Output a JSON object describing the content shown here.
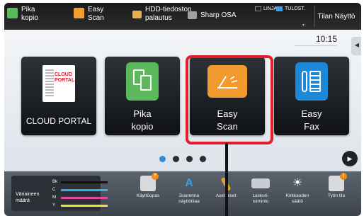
{
  "topbar": {
    "quick": [
      {
        "label": "Pika\nkopio",
        "icon": "copy-icon",
        "color": "#5cb85c"
      },
      {
        "label": "Easy\nScan",
        "icon": "scan-icon",
        "color": "#f0a030"
      },
      {
        "label": "HDD-tiedoston\npalautus",
        "icon": "folder-icon",
        "color": "#e8b04a"
      },
      {
        "label": "Sharp OSA",
        "icon": "osa-icon",
        "color": "#a0a0a0"
      }
    ],
    "status_line": "LINJA",
    "status_print": "TULOST.",
    "system_status": "Tilan Näyttö"
  },
  "main": {
    "clock": "10:15",
    "tiles": [
      {
        "label": "CLOUD PORTAL",
        "icon": "cloud-portal-icon",
        "logo_text": "CLOUD\nPORTAL"
      },
      {
        "label": "Pika\nkopio",
        "icon": "copy-icon",
        "color": "#5cb85c"
      },
      {
        "label": "Easy\nScan",
        "icon": "scan-icon",
        "color": "#f29a2e"
      },
      {
        "label": "Easy\nFax",
        "icon": "fax-icon",
        "color": "#1e88d8"
      }
    ],
    "page_dots": 4,
    "active_dot": 0
  },
  "bottombar": {
    "toner_label": "Väriaineen\nmäärä",
    "toner": [
      {
        "letter": "Bk",
        "color": "#111111"
      },
      {
        "letter": "C",
        "color": "#2fb3e6"
      },
      {
        "letter": "M",
        "color": "#e14aa0"
      },
      {
        "letter": "Y",
        "color": "#f2e03a"
      }
    ],
    "tools": [
      {
        "label": "Käyttöopas",
        "icon": "manual-icon"
      },
      {
        "label": "Suurenna\nnäyttötilaa",
        "icon": "enlarge-display-icon"
      },
      {
        "label": "Asetukset",
        "icon": "settings-icon"
      },
      {
        "label": "Laskuri-\ntoiminto",
        "icon": "counter-icon"
      },
      {
        "label": "Kirkkauden\nsäätö",
        "icon": "brightness-icon"
      },
      {
        "label": "Työn tila",
        "icon": "job-status-icon"
      }
    ]
  }
}
